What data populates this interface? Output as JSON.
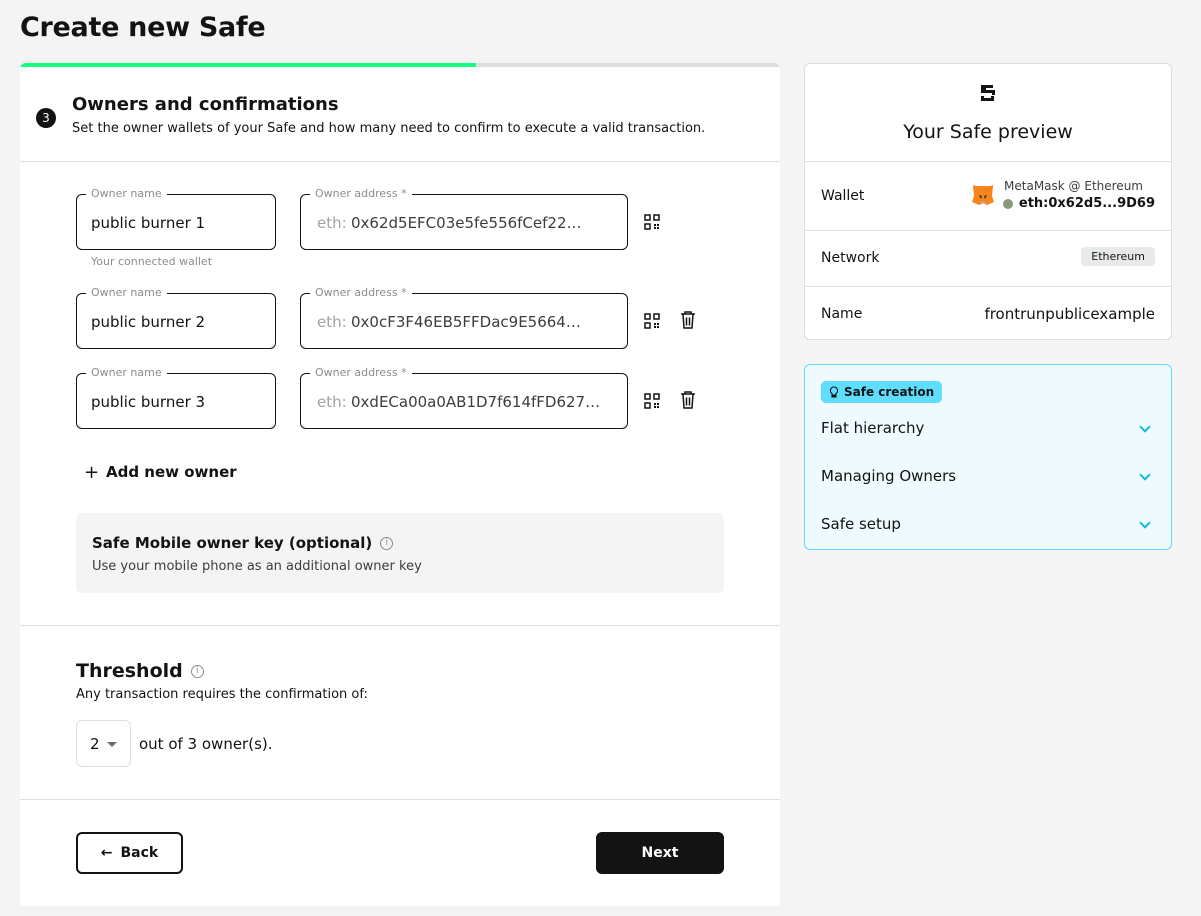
{
  "page": {
    "title": "Create new Safe"
  },
  "progress": {
    "percent": 60
  },
  "step": {
    "number": "3",
    "title": "Owners and confirmations",
    "subtitle": "Set the owner wallets of your Safe and how many need to confirm to execute a valid transaction."
  },
  "owners": [
    {
      "name_label": "Owner name",
      "name": "public burner 1",
      "address_label": "Owner address *",
      "prefix": "eth:",
      "address": "0x62d5EFC03e5fe556fCef22…",
      "helper": "Your connected wallet",
      "deletable": false
    },
    {
      "name_label": "Owner name",
      "name": "public burner 2",
      "address_label": "Owner address *",
      "prefix": "eth:",
      "address": "0x0cF3F46EB5FFDac9E5664…",
      "helper": "",
      "deletable": true
    },
    {
      "name_label": "Owner name",
      "name": "public burner 3",
      "address_label": "Owner address *",
      "prefix": "eth:",
      "address": "0xdECa00a0AB1D7f614fFD627…",
      "helper": "",
      "deletable": true
    }
  ],
  "add_owner": {
    "label": "Add new owner"
  },
  "mobile_key": {
    "title": "Safe Mobile owner key (optional)",
    "description": "Use your mobile phone as an additional owner key"
  },
  "threshold": {
    "title": "Threshold",
    "description": "Any transaction requires the confirmation of:",
    "value": "2",
    "suffix": "out of 3 owner(s)."
  },
  "buttons": {
    "back": "Back",
    "next": "Next"
  },
  "preview": {
    "title": "Your Safe preview",
    "wallet_label": "Wallet",
    "wallet_name": "MetaMask @ Ethereum",
    "wallet_address": "eth:0x62d5...9D69",
    "network_label": "Network",
    "network_value": "Ethereum",
    "name_label": "Name",
    "name_value": "frontrunpublicexample"
  },
  "creation": {
    "chip": "Safe creation",
    "items": [
      "Flat hierarchy",
      "Managing Owners",
      "Safe setup"
    ]
  },
  "colors": {
    "accent": "#12ff80",
    "info": "#5fddff",
    "dark": "#121312"
  }
}
